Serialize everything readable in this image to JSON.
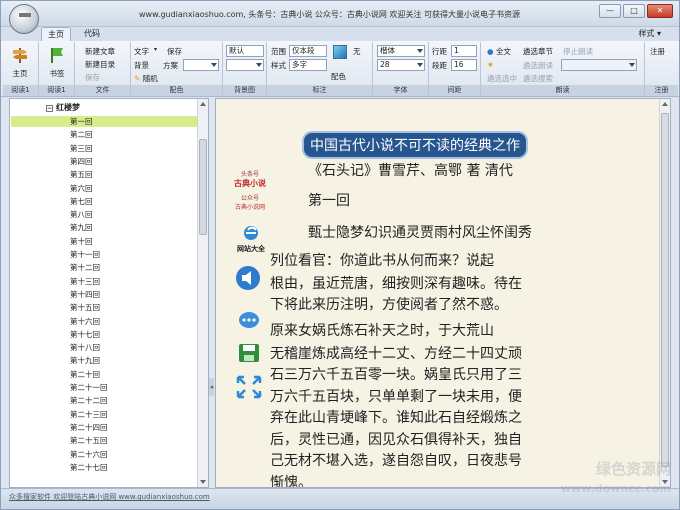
{
  "window": {
    "title": "www.gudianxiaoshuo.com, 头条号：古典小说  公众号：古典小说网  欢迎关注 可获得大量小说电子书资源",
    "min_glyph": "—",
    "max_glyph": "□",
    "close_glyph": "✕"
  },
  "tabs": [
    "主页",
    "代码"
  ],
  "style_menu": "样式 ▾",
  "ribbon": {
    "home": {
      "label": "主页",
      "group": "阅读1"
    },
    "bookshelf": {
      "label": "书签",
      "group": "阅读1"
    },
    "file": {
      "new_article": "新建文章",
      "new_dir": "新建目录",
      "save": "保存",
      "group": "文件"
    },
    "color": {
      "text": "文字",
      "save": "保存",
      "background": "背景",
      "scheme": "方案",
      "random": "随机",
      "group": "配色"
    },
    "bgimage": {
      "value": "默认",
      "value2": "",
      "group": "背景图"
    },
    "mark": {
      "range_label": "范围",
      "range_value": "仅本段",
      "style_label": "样式",
      "style_value": "多字",
      "color_label": "配色",
      "none_label": "无",
      "group": "标注"
    },
    "font": {
      "family": "楷体",
      "size": "28",
      "group": "字体"
    },
    "spacing": {
      "line_label": "行距",
      "line_value": "1",
      "para_label": "段距",
      "para_value": "16",
      "group": "间距"
    },
    "read": {
      "fulltext": "全文",
      "pick_chapter": "遴选章节",
      "stop_read": "停止朗读",
      "pick_read": "遴选朗读",
      "pick_sel": "遴选选中",
      "pick_search": "遴选搜索",
      "group": "朗读"
    },
    "register": {
      "label": "注册",
      "group": "注册"
    }
  },
  "tree": {
    "root": "红楼梦",
    "items": [
      "第一回",
      "第二回",
      "第三回",
      "第四回",
      "第五回",
      "第六回",
      "第七回",
      "第八回",
      "第九回",
      "第十回",
      "第十一回",
      "第十二回",
      "第十三回",
      "第十四回",
      "第十五回",
      "第十六回",
      "第十七回",
      "第十八回",
      "第十九回",
      "第二十回",
      "第二十一回",
      "第二十二回",
      "第二十三回",
      "第二十四回",
      "第二十五回",
      "第二十六回",
      "第二十七回"
    ],
    "selected_index": 0
  },
  "reader": {
    "side": {
      "logo_top": "头条号",
      "logo_main": "古典小说",
      "logo_sub": "公众号",
      "logo_sub2": "古典小说网",
      "site_label": "网站大全"
    },
    "heading": "中国古代小说不可不读的经典之作",
    "lines": [
      "《石头记》曹雪芹、高鄂 著 清代",
      "第一回",
      "甄士隐梦幻识通灵贾雨村风尘怀闺秀",
      "    列位看官：你道此书从何而来？说起",
      "根由，虽近荒唐，细按则深有趣味。待在",
      "下将此来历注明，方使阅者了然不惑。",
      "    原来女娲氏炼石补天之时，于大荒山",
      "无稽崖炼成高经十二丈、方经二十四丈顽",
      "石三万六千五百零一块。娲皇氏只用了三",
      "万六千五百块，只单单剩了一块未用，便",
      "弃在此山青埂峰下。谁知此石自经煅炼之",
      "后，灵性已通，因见众石俱得补天，独自",
      "己无材不堪入选，遂自怨自叹，日夜悲号",
      "惭愧。"
    ]
  },
  "status": "众多搜家软件 欢迎登陆古典小说网 www.gudianxiaoshuo.com",
  "watermark": {
    "line1": "绿色资源网",
    "line2": "www.downcc.com"
  },
  "colors": {
    "accent": "#27558f",
    "selected": "#d7ec8a",
    "paper": "#f6f2e4"
  }
}
